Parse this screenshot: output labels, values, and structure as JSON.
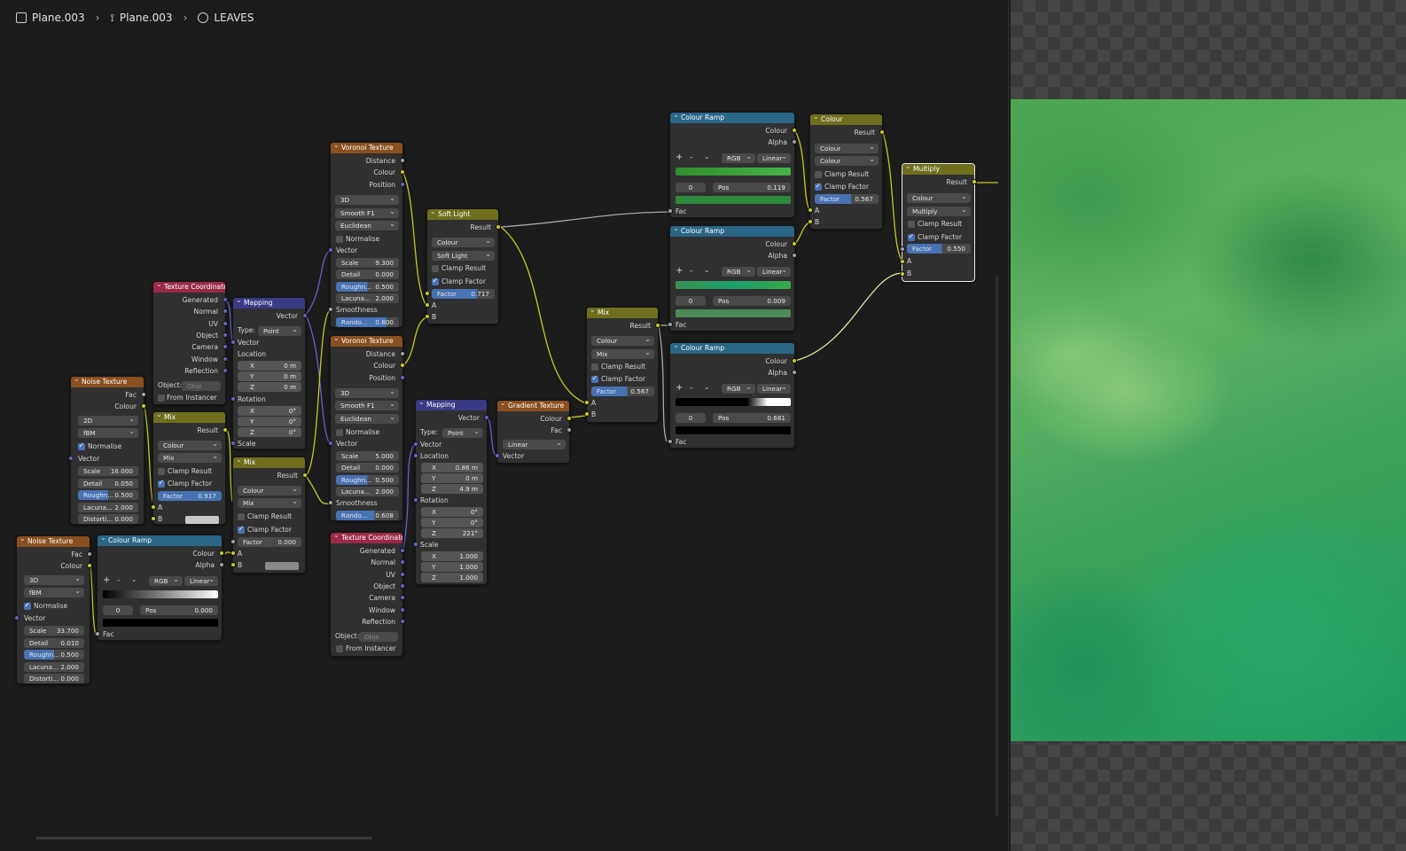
{
  "header": {
    "object": "Plane.003",
    "mesh": "Plane.003",
    "material": "LEAVES"
  },
  "lbl": {
    "fac": "Fac",
    "colour": "Colour",
    "vector": "Vector",
    "result": "Result",
    "a": "A",
    "b": "B",
    "alpha": "Alpha",
    "distance": "Distance",
    "position": "Position",
    "generated": "Generated",
    "normal": "Normal",
    "uv": "UV",
    "object": "Object",
    "camera": "Camera",
    "window": "Window",
    "reflection": "Reflection",
    "location": "Location",
    "rotation": "Rotation",
    "scale": "Scale",
    "smoothness": "Smoothness",
    "x": "X",
    "y": "Y",
    "z": "Z",
    "normalise": "Normalise",
    "clamp_result": "Clamp Result",
    "clamp_factor": "Clamp Factor",
    "from_instancer": "From Instancer",
    "object_field": "Object:",
    "type": "Type:",
    "point": "Point",
    "mix": "Mix",
    "rgb": "RGB",
    "linear": "Linear",
    "d2": "2D",
    "d3": "3D",
    "fbm": "fBM",
    "smoothf1": "Smooth F1",
    "euclidean": "Euclidean",
    "factor": "Factor",
    "detail": "Detail",
    "rough": "Roughn...",
    "lacuna": "Lacuna...",
    "distort": "Distorti...",
    "rando": "Rando...",
    "pos": "Pos",
    "zero": "0",
    "plus": "+",
    "minus": "–",
    "chev": "⌄",
    "objph": "Obje",
    "softlight": "Soft Light",
    "multiply": "Multiply",
    "zm": "0 m",
    "zd": "0°",
    "one": "1.000"
  },
  "nodes": {
    "noise1": {
      "title": "Noise Texture",
      "scale": "16.000",
      "detail": "0.050",
      "rough": "0.500",
      "lacuna": "2.000",
      "distort": "0.000"
    },
    "noise2": {
      "title": "Noise Texture",
      "scale": "33.700",
      "detail": "0.010",
      "rough": "0.500",
      "lacuna": "2.000",
      "distort": "0.000"
    },
    "texcoord1": {
      "title": "Texture Coordinate"
    },
    "texcoord2": {
      "title": "Texture Coordinate"
    },
    "mapping1": {
      "title": "Mapping"
    },
    "mapping2": {
      "title": "Mapping",
      "lx": "0.86 m",
      "ly": "0 m",
      "lz": "4.9 m",
      "rz": "221°"
    },
    "mix1": {
      "title": "Mix",
      "factor": "0.917"
    },
    "mix2": {
      "title": "Mix",
      "factor": "0.000"
    },
    "mix3": {
      "title": "Mix",
      "factor": "0.567"
    },
    "ramp1": {
      "title": "Colour Ramp",
      "pos": "0.000"
    },
    "voronoi1": {
      "title": "Voronoi Texture",
      "scale": "9.300",
      "detail": "0.000",
      "rough": "0.500",
      "lacuna": "2.000",
      "rando": "0.800"
    },
    "voronoi2": {
      "title": "Voronoi Texture",
      "scale": "5.000",
      "detail": "0.000",
      "rough": "0.500",
      "lacuna": "2.000",
      "rando": "0.608"
    },
    "softlight": {
      "title": "Soft Light",
      "factor": "0.717"
    },
    "gradient": {
      "title": "Gradient Texture"
    },
    "ramp2": {
      "title": "Colour Ramp",
      "pos": "0.119"
    },
    "ramp3": {
      "title": "Colour Ramp",
      "pos": "0.009"
    },
    "ramp4": {
      "title": "Colour Ramp",
      "pos": "0.681"
    },
    "colour": {
      "title": "Colour",
      "factor": "0.567"
    },
    "multiply": {
      "title": "Multiply",
      "factor": "0.550"
    }
  },
  "colors": {
    "texture_header": "#8a4f1e",
    "input_header": "#9b2a48",
    "vector_header": "#3a3a86",
    "color_header": "#6e6e1d",
    "converter_header": "#2a6686",
    "color_socket": "#c7c729",
    "float_socket": "#a1a1a1",
    "vector_socket": "#6363c7",
    "accent": "#4772b3"
  }
}
